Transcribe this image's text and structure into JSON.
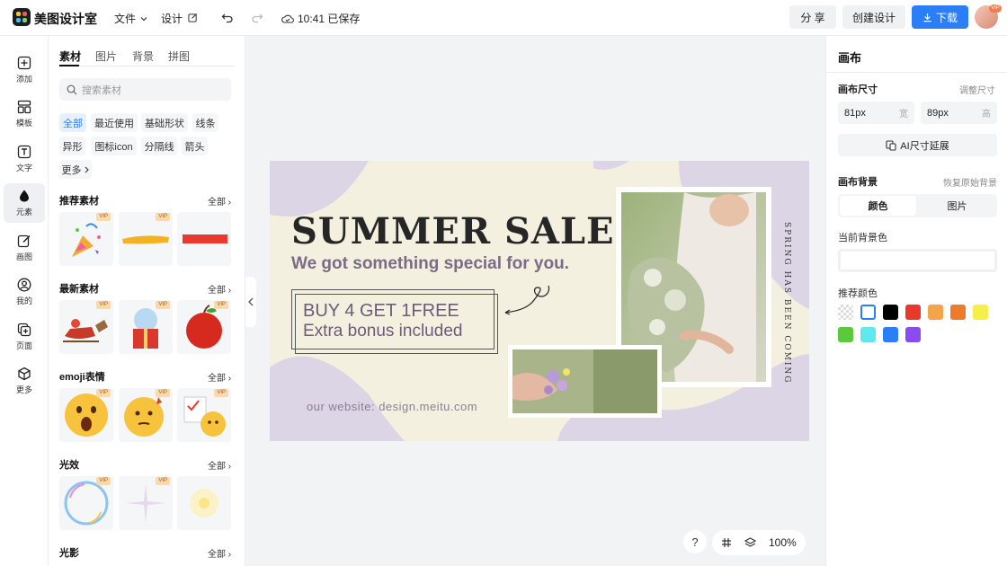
{
  "app": {
    "name": "美图设计室",
    "menu_file": "文件",
    "menu_design": "设计",
    "save_status": "10:41 已保存",
    "share": "分 享",
    "create": "创建设计",
    "download": "下载",
    "avatar_badge": "VIP"
  },
  "rail": [
    {
      "label": "添加",
      "icon": "plus-square-icon"
    },
    {
      "label": "模板",
      "icon": "template-icon"
    },
    {
      "label": "文字",
      "icon": "text-icon"
    },
    {
      "label": "元素",
      "icon": "shapes-icon"
    },
    {
      "label": "画图",
      "icon": "pencil-icon"
    },
    {
      "label": "我的",
      "icon": "user-icon"
    },
    {
      "label": "页面",
      "icon": "add-page-icon"
    },
    {
      "label": "更多",
      "icon": "cube-icon"
    }
  ],
  "panel": {
    "tabs": [
      "素材",
      "图片",
      "背景",
      "拼图"
    ],
    "search_placeholder": "搜索素材",
    "chips": [
      "全部",
      "最近使用",
      "基础形状",
      "线条",
      "异形",
      "图标icon",
      "分隔线",
      "箭头",
      "更多"
    ],
    "all_label": "全部",
    "vip_label": "VIP",
    "sections": [
      "推荐素材",
      "最新素材",
      "emoji表情",
      "光效",
      "光影"
    ]
  },
  "artboard": {
    "title": "SUMMER SALE",
    "subtitle": "We got something special for you.",
    "buy_line_1": "BUY  4 GET   1FREE",
    "buy_line_2": "Extra bonus included",
    "website": "our website: design.meitu.com",
    "vertical_text": "SPRING HAS BEEN COMING",
    "colors": {
      "background": "#f4f0e0",
      "blob": "#dcd5e6"
    }
  },
  "bottom": {
    "help": "?",
    "zoom": "100%"
  },
  "rpanel": {
    "title": "画布",
    "size_label": "画布尺寸",
    "adjust_size": "调整尺寸",
    "width_value": "81px",
    "width_unit": "宽",
    "height_value": "89px",
    "height_unit": "高",
    "ai_button": "AI尺寸延展",
    "bg_label": "画布背景",
    "restore_bg": "恢复原始背景",
    "bg_tabs": [
      "颜色",
      "图片"
    ],
    "current_color_label": "当前背景色",
    "recommended_label": "推荐颜色",
    "swatches": [
      "transparent",
      "#ffffff",
      "#000000",
      "#e8392a",
      "#f3a54a",
      "#ee7a2c",
      "#f5ef4a",
      "#5cc83d",
      "#5ee8f0",
      "#2b7ef5",
      "#8a4cf0"
    ]
  }
}
